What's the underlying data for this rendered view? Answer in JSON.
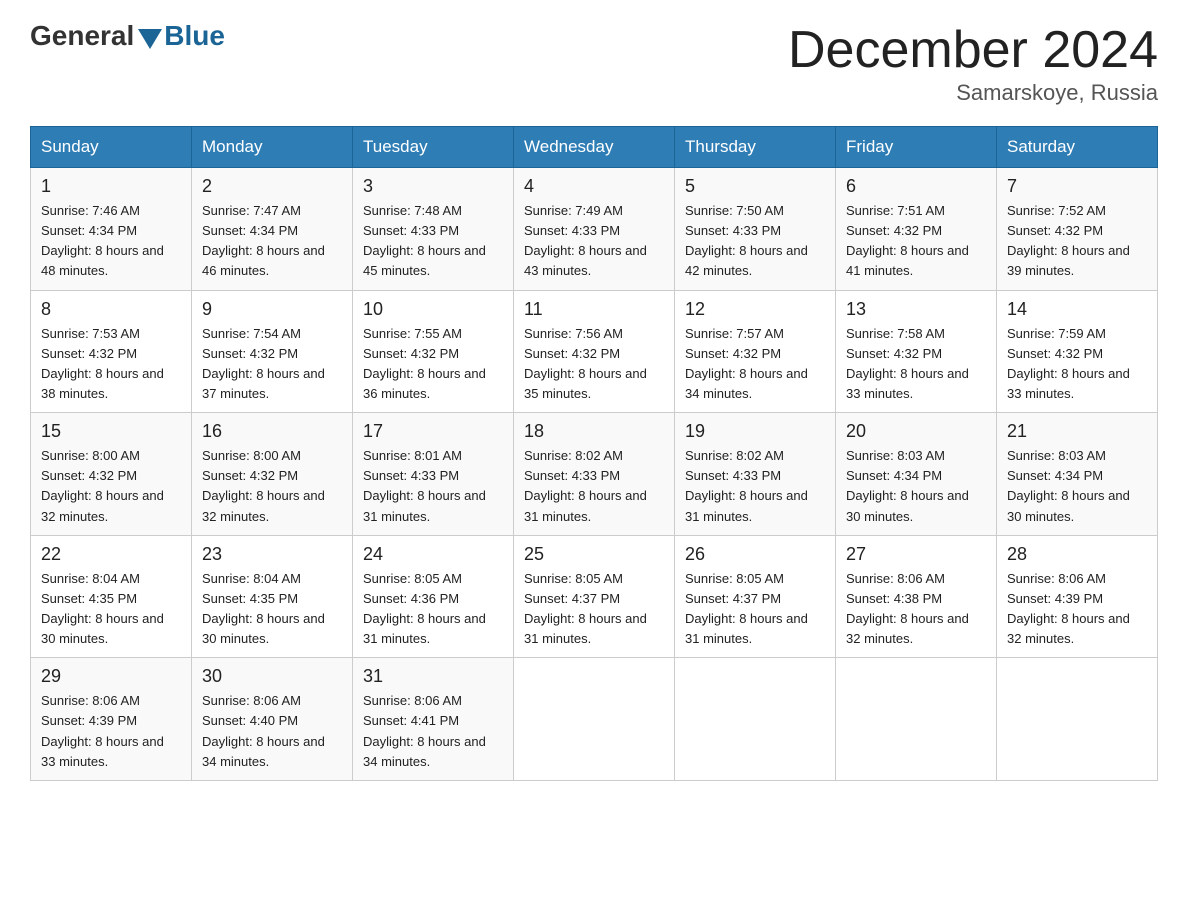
{
  "logo": {
    "general": "General",
    "blue": "Blue"
  },
  "title": "December 2024",
  "location": "Samarskoye, Russia",
  "days_of_week": [
    "Sunday",
    "Monday",
    "Tuesday",
    "Wednesday",
    "Thursday",
    "Friday",
    "Saturday"
  ],
  "weeks": [
    [
      {
        "day": "1",
        "sunrise": "7:46 AM",
        "sunset": "4:34 PM",
        "daylight": "8 hours and 48 minutes."
      },
      {
        "day": "2",
        "sunrise": "7:47 AM",
        "sunset": "4:34 PM",
        "daylight": "8 hours and 46 minutes."
      },
      {
        "day": "3",
        "sunrise": "7:48 AM",
        "sunset": "4:33 PM",
        "daylight": "8 hours and 45 minutes."
      },
      {
        "day": "4",
        "sunrise": "7:49 AM",
        "sunset": "4:33 PM",
        "daylight": "8 hours and 43 minutes."
      },
      {
        "day": "5",
        "sunrise": "7:50 AM",
        "sunset": "4:33 PM",
        "daylight": "8 hours and 42 minutes."
      },
      {
        "day": "6",
        "sunrise": "7:51 AM",
        "sunset": "4:32 PM",
        "daylight": "8 hours and 41 minutes."
      },
      {
        "day": "7",
        "sunrise": "7:52 AM",
        "sunset": "4:32 PM",
        "daylight": "8 hours and 39 minutes."
      }
    ],
    [
      {
        "day": "8",
        "sunrise": "7:53 AM",
        "sunset": "4:32 PM",
        "daylight": "8 hours and 38 minutes."
      },
      {
        "day": "9",
        "sunrise": "7:54 AM",
        "sunset": "4:32 PM",
        "daylight": "8 hours and 37 minutes."
      },
      {
        "day": "10",
        "sunrise": "7:55 AM",
        "sunset": "4:32 PM",
        "daylight": "8 hours and 36 minutes."
      },
      {
        "day": "11",
        "sunrise": "7:56 AM",
        "sunset": "4:32 PM",
        "daylight": "8 hours and 35 minutes."
      },
      {
        "day": "12",
        "sunrise": "7:57 AM",
        "sunset": "4:32 PM",
        "daylight": "8 hours and 34 minutes."
      },
      {
        "day": "13",
        "sunrise": "7:58 AM",
        "sunset": "4:32 PM",
        "daylight": "8 hours and 33 minutes."
      },
      {
        "day": "14",
        "sunrise": "7:59 AM",
        "sunset": "4:32 PM",
        "daylight": "8 hours and 33 minutes."
      }
    ],
    [
      {
        "day": "15",
        "sunrise": "8:00 AM",
        "sunset": "4:32 PM",
        "daylight": "8 hours and 32 minutes."
      },
      {
        "day": "16",
        "sunrise": "8:00 AM",
        "sunset": "4:32 PM",
        "daylight": "8 hours and 32 minutes."
      },
      {
        "day": "17",
        "sunrise": "8:01 AM",
        "sunset": "4:33 PM",
        "daylight": "8 hours and 31 minutes."
      },
      {
        "day": "18",
        "sunrise": "8:02 AM",
        "sunset": "4:33 PM",
        "daylight": "8 hours and 31 minutes."
      },
      {
        "day": "19",
        "sunrise": "8:02 AM",
        "sunset": "4:33 PM",
        "daylight": "8 hours and 31 minutes."
      },
      {
        "day": "20",
        "sunrise": "8:03 AM",
        "sunset": "4:34 PM",
        "daylight": "8 hours and 30 minutes."
      },
      {
        "day": "21",
        "sunrise": "8:03 AM",
        "sunset": "4:34 PM",
        "daylight": "8 hours and 30 minutes."
      }
    ],
    [
      {
        "day": "22",
        "sunrise": "8:04 AM",
        "sunset": "4:35 PM",
        "daylight": "8 hours and 30 minutes."
      },
      {
        "day": "23",
        "sunrise": "8:04 AM",
        "sunset": "4:35 PM",
        "daylight": "8 hours and 30 minutes."
      },
      {
        "day": "24",
        "sunrise": "8:05 AM",
        "sunset": "4:36 PM",
        "daylight": "8 hours and 31 minutes."
      },
      {
        "day": "25",
        "sunrise": "8:05 AM",
        "sunset": "4:37 PM",
        "daylight": "8 hours and 31 minutes."
      },
      {
        "day": "26",
        "sunrise": "8:05 AM",
        "sunset": "4:37 PM",
        "daylight": "8 hours and 31 minutes."
      },
      {
        "day": "27",
        "sunrise": "8:06 AM",
        "sunset": "4:38 PM",
        "daylight": "8 hours and 32 minutes."
      },
      {
        "day": "28",
        "sunrise": "8:06 AM",
        "sunset": "4:39 PM",
        "daylight": "8 hours and 32 minutes."
      }
    ],
    [
      {
        "day": "29",
        "sunrise": "8:06 AM",
        "sunset": "4:39 PM",
        "daylight": "8 hours and 33 minutes."
      },
      {
        "day": "30",
        "sunrise": "8:06 AM",
        "sunset": "4:40 PM",
        "daylight": "8 hours and 34 minutes."
      },
      {
        "day": "31",
        "sunrise": "8:06 AM",
        "sunset": "4:41 PM",
        "daylight": "8 hours and 34 minutes."
      },
      null,
      null,
      null,
      null
    ]
  ]
}
